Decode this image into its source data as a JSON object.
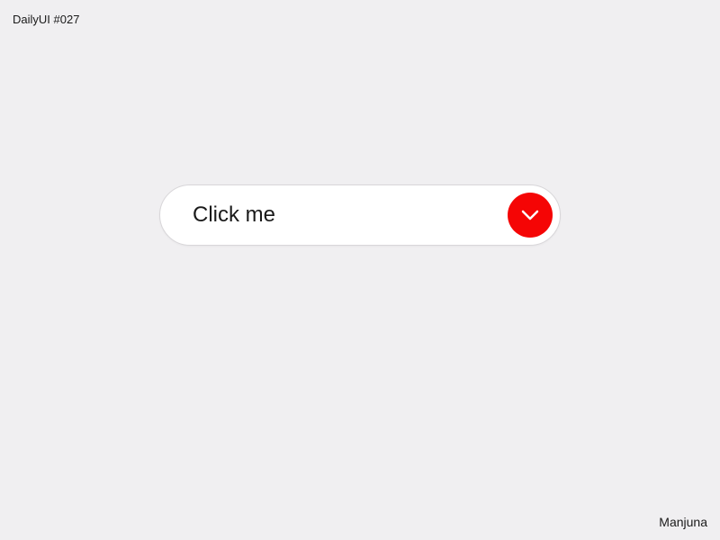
{
  "header": {
    "label": "DailyUI #027"
  },
  "dropdown": {
    "label": "Click me"
  },
  "footer": {
    "author": "Manjuna"
  },
  "colors": {
    "accent": "#f50505",
    "background": "#f0eff1",
    "surface": "#ffffff"
  }
}
